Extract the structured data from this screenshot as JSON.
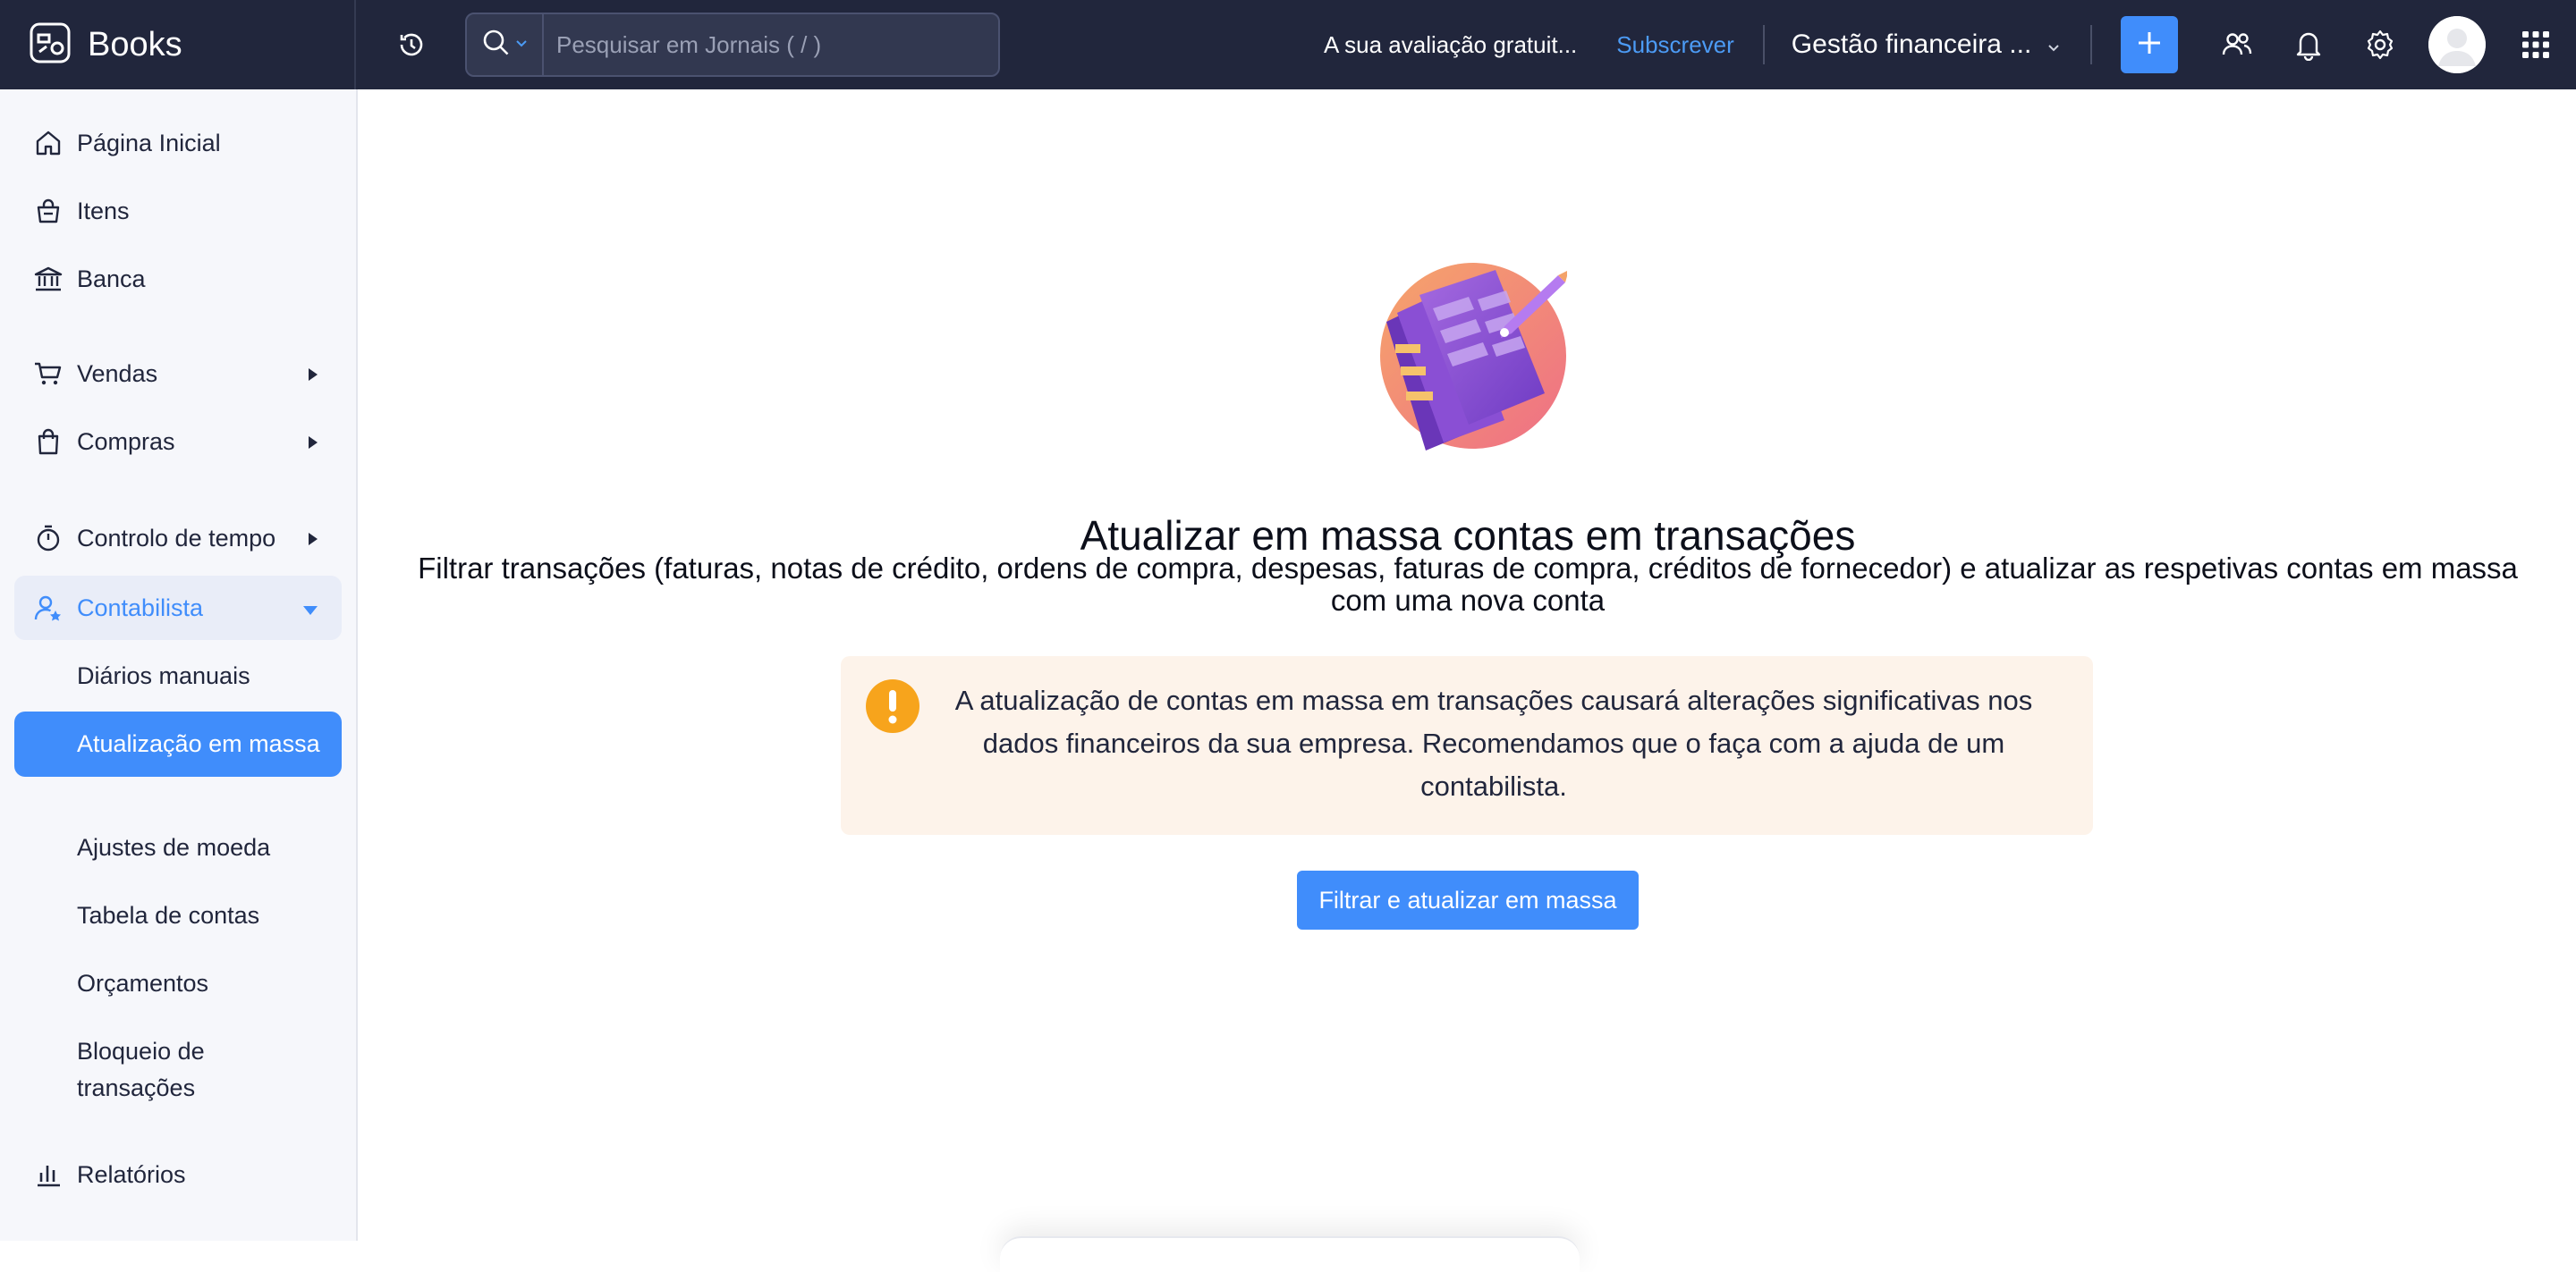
{
  "app": {
    "name": "Books"
  },
  "header": {
    "search_placeholder": "Pesquisar em Jornais ( / )",
    "trial_text": "A sua avaliação gratuit...",
    "subscribe_label": "Subscrever",
    "org_name": "Gestão financeira ..."
  },
  "sidebar": {
    "items": [
      {
        "label": "Página Inicial",
        "icon": "home-icon"
      },
      {
        "label": "Itens",
        "icon": "basket-icon"
      },
      {
        "label": "Banca",
        "icon": "bank-icon"
      },
      {
        "label": "Vendas",
        "icon": "cart-icon"
      },
      {
        "label": "Compras",
        "icon": "shopping-bag-icon"
      },
      {
        "label": "Controlo de tempo",
        "icon": "stopwatch-icon"
      },
      {
        "label": "Contabilista",
        "icon": "accountant-icon"
      },
      {
        "label": "Relatórios",
        "icon": "bar-chart-icon"
      }
    ],
    "accountant_sub": [
      "Diários manuais",
      "Atualização em massa",
      "Ajustes de moeda",
      "Tabela de contas",
      "Orçamentos",
      "Bloqueio de transações"
    ],
    "selected_sub": "Atualização em massa"
  },
  "main": {
    "title": "Atualizar em massa contas em transações",
    "description": "Filtrar transações (faturas, notas de crédito, ordens de compra, despesas, faturas de compra, créditos de fornecedor) e atualizar as respetivas contas em massa com uma nova conta",
    "warning": "A atualização de contas em massa em transações causará alterações significativas nos dados financeiros da sua empresa. Recomendamos que o faça com a ajuda de um contabilista.",
    "button_label": "Filtrar e atualizar em massa"
  },
  "colors": {
    "topbar": "#21263c",
    "accent": "#408dfb",
    "sidebar_bg": "#f6f7fb",
    "warning_bg": "#fdf3ea",
    "warning_icon": "#f7a41c"
  }
}
